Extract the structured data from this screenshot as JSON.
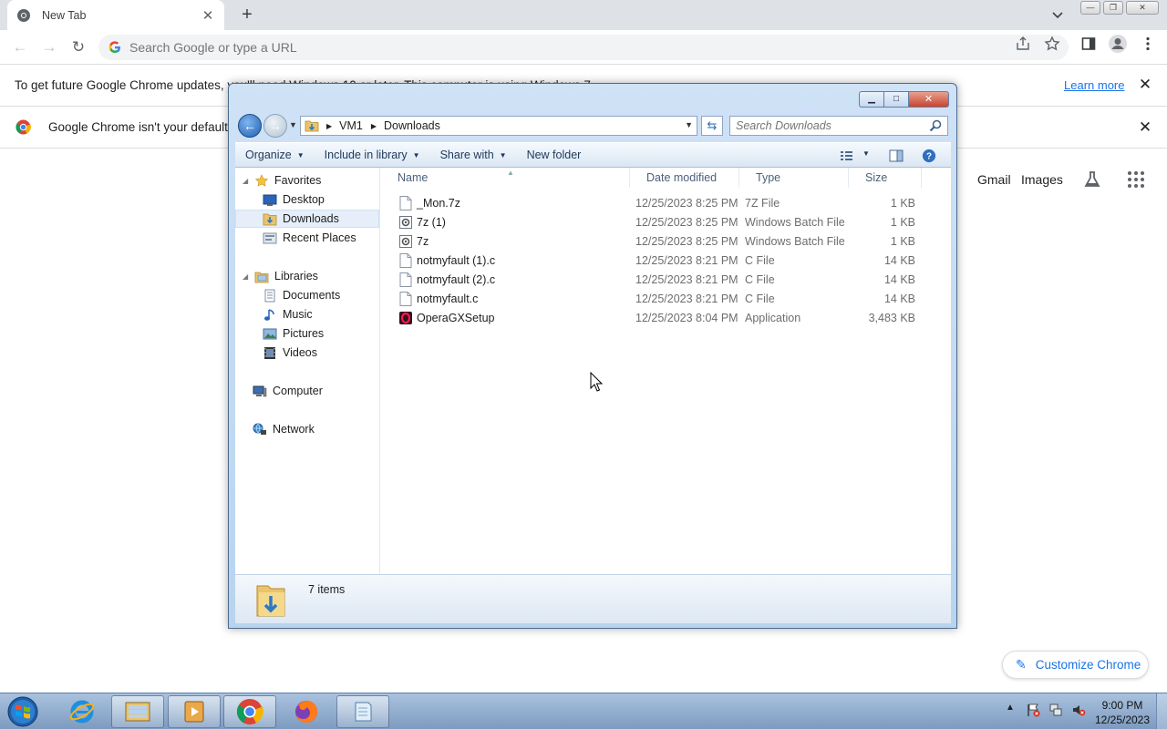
{
  "chrome": {
    "tab_title": "New Tab",
    "omnibox_placeholder": "Search Google or type a URL",
    "infobar_update": {
      "text": "To get future Google Chrome updates, you'll need Windows 10 or later. This computer is using Windows 7.",
      "link": "Learn more"
    },
    "infobar_default": {
      "text": "Google Chrome isn't your default browser"
    },
    "ntp_links": {
      "gmail": "Gmail",
      "images": "Images"
    },
    "customize_label": "Customize Chrome"
  },
  "explorer": {
    "breadcrumb": [
      "VM1",
      "Downloads"
    ],
    "search_placeholder": "Search Downloads",
    "commands": {
      "organize": "Organize",
      "include": "Include in library",
      "share": "Share with",
      "new_folder": "New folder"
    },
    "nav": {
      "favorites": "Favorites",
      "desktop": "Desktop",
      "downloads": "Downloads",
      "recent": "Recent Places",
      "libraries": "Libraries",
      "documents": "Documents",
      "music": "Music",
      "pictures": "Pictures",
      "videos": "Videos",
      "computer": "Computer",
      "network": "Network"
    },
    "columns": {
      "name": "Name",
      "date": "Date modified",
      "type": "Type",
      "size": "Size"
    },
    "files": [
      {
        "name": "_Mon.7z",
        "date": "12/25/2023 8:25 PM",
        "type": "7Z File",
        "size": "1 KB",
        "icon": "file-icon"
      },
      {
        "name": "7z (1)",
        "date": "12/25/2023 8:25 PM",
        "type": "Windows Batch File",
        "size": "1 KB",
        "icon": "batch-file-icon"
      },
      {
        "name": "7z",
        "date": "12/25/2023 8:25 PM",
        "type": "Windows Batch File",
        "size": "1 KB",
        "icon": "batch-file-icon"
      },
      {
        "name": "notmyfault (1).c",
        "date": "12/25/2023 8:21 PM",
        "type": "C File",
        "size": "14 KB",
        "icon": "file-icon"
      },
      {
        "name": "notmyfault (2).c",
        "date": "12/25/2023 8:21 PM",
        "type": "C File",
        "size": "14 KB",
        "icon": "file-icon"
      },
      {
        "name": "notmyfault.c",
        "date": "12/25/2023 8:21 PM",
        "type": "C File",
        "size": "14 KB",
        "icon": "file-icon"
      },
      {
        "name": "OperaGXSetup",
        "date": "12/25/2023 8:04 PM",
        "type": "Application",
        "size": "3,483 KB",
        "icon": "opera-gx-icon"
      }
    ],
    "status": "7 items"
  },
  "taskbar": {
    "time": "9:00 PM",
    "date": "12/25/2023"
  }
}
